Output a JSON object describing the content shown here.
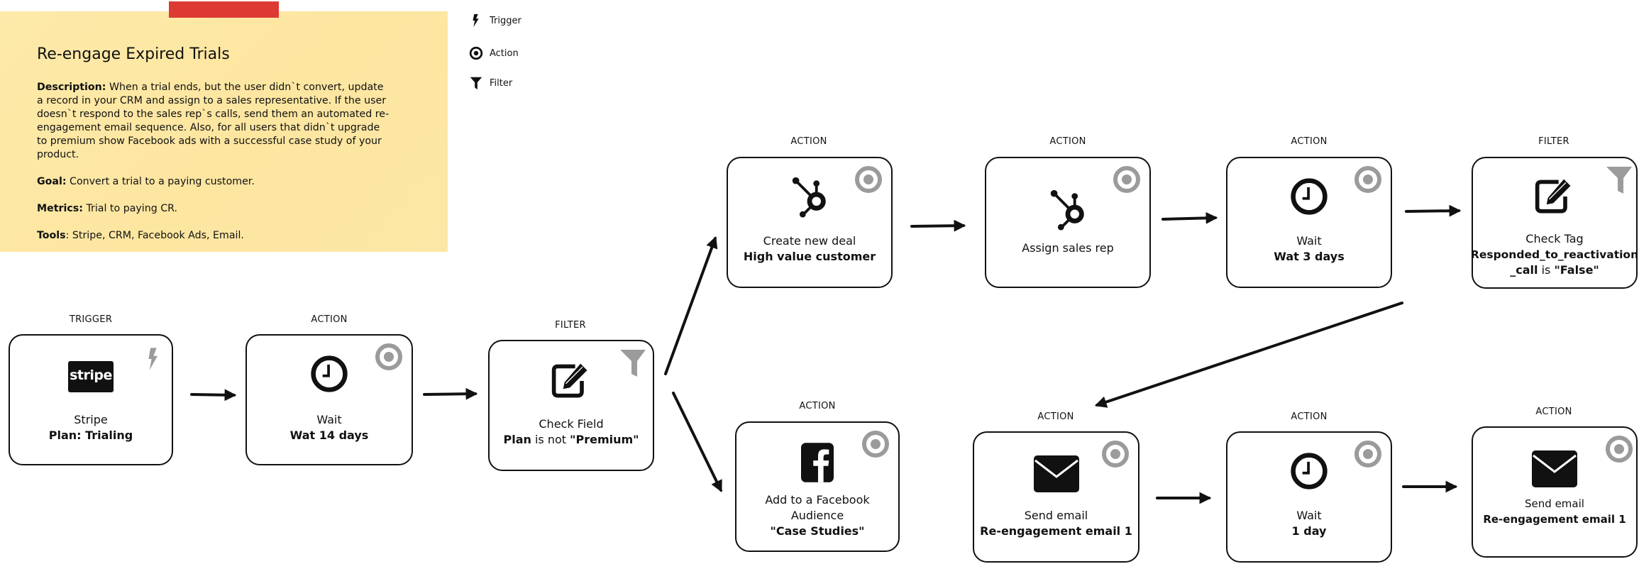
{
  "note": {
    "title": "Re-engage Expired Trials",
    "description_label": "Description:",
    "description": "When a trial ends, but the user didn`t convert, update a record in your CRM and assign to a sales representative. If the user doesn`t respond to the sales rep`s calls, send them an automated re-engagement email sequence. Also, for all users that didn`t upgrade to premium show Facebook ads with a successful case study of your product.",
    "goal_label": "Goal:",
    "goal": "Convert a trial to a paying customer.",
    "metrics_label": "Metrics:",
    "metrics": "Trial to paying CR.",
    "tools_label": "Tools",
    "tools": ": Stripe, CRM, Facebook Ads, Email.",
    "colors": {
      "paper": "#fde8a7",
      "tape": "#de3a34"
    }
  },
  "legend": [
    {
      "icon": "bolt-icon",
      "label": "Trigger"
    },
    {
      "icon": "target-icon",
      "label": "Action"
    },
    {
      "icon": "funnel-icon",
      "label": "Filter"
    }
  ],
  "nodes": {
    "stripe": {
      "type": "TRIGGER",
      "icon": "stripe-logo",
      "stripe_text": "stripe",
      "title": "Stripe",
      "detail": "Plan: Trialing"
    },
    "wait14": {
      "type": "ACTION",
      "icon": "clock-icon",
      "title": "Wait",
      "detail": "Wat 14 days"
    },
    "check_field": {
      "type": "FILTER",
      "icon": "edit-icon",
      "title": "Check Field",
      "detail_a": "Plan",
      "detail_b": " is not ",
      "detail_c": "\"Premium\""
    },
    "create_deal": {
      "type": "ACTION",
      "icon": "hubspot-icon",
      "title": "Create new deal",
      "detail": "High value customer"
    },
    "assign_rep": {
      "type": "ACTION",
      "icon": "hubspot-icon",
      "title": "Assign sales rep"
    },
    "wait3": {
      "type": "ACTION",
      "icon": "clock-icon",
      "title": "Wait",
      "detail": "Wat 3 days"
    },
    "check_tag": {
      "type": "FILTER",
      "icon": "edit-icon",
      "title": "Check Tag",
      "detail_a": "Responded_to_reactivation",
      "detail_b": "_call",
      "detail_c": " is ",
      "detail_d": "\"False\""
    },
    "facebook": {
      "type": "ACTION",
      "icon": "facebook-icon",
      "title": "Add to a Facebook",
      "title2": "Audience",
      "detail": "\"Case Studies\""
    },
    "email1": {
      "type": "ACTION",
      "icon": "envelope-icon",
      "title": "Send email",
      "detail": "Re-engagement email 1"
    },
    "wait1": {
      "type": "ACTION",
      "icon": "clock-icon",
      "title": "Wait",
      "detail": "1 day"
    },
    "email2": {
      "type": "ACTION",
      "icon": "envelope-icon",
      "title": "Send email",
      "detail": "Re-engagement email 1"
    }
  },
  "colors": {
    "stroke": "#111111",
    "badge": "#9b9b9b"
  }
}
